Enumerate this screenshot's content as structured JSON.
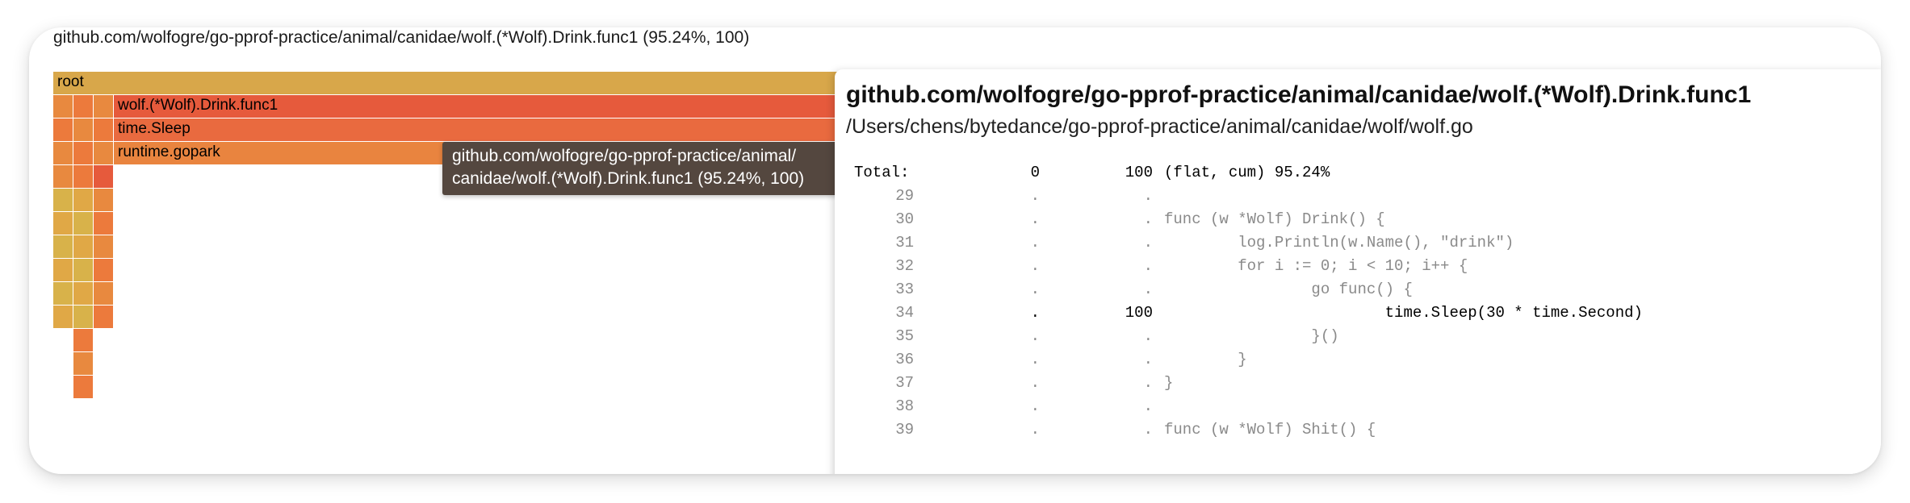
{
  "header": {
    "hover_text": "github.com/wolfogre/go-pprof-practice/animal/canidae/wolf.(*Wolf).Drink.func1 (95.24%, 100)"
  },
  "flamegraph": {
    "frames": [
      {
        "label": "root"
      },
      {
        "label": "wolf.(*Wolf).Drink.func1"
      },
      {
        "label": "time.Sleep"
      },
      {
        "label": "runtime.gopark"
      }
    ]
  },
  "tooltip": {
    "line1": "github.com/wolfogre/go-pprof-practice/animal/",
    "line2": "canidae/wolf.(*Wolf).Drink.func1 (95.24%, 100)"
  },
  "source_panel": {
    "title": "github.com/wolfogre/go-pprof-practice/animal/canidae/wolf.(*Wolf).Drink.func1",
    "path": "/Users/chens/bytedance/go-pprof-practice/animal/canidae/wolf/wolf.go",
    "total": {
      "label": "Total:",
      "flat": "0",
      "cum": "100",
      "text": "(flat, cum) 95.24%"
    },
    "lines": [
      {
        "num": "29",
        "flat": ".",
        "cum": ".",
        "src": ""
      },
      {
        "num": "30",
        "flat": ".",
        "cum": ".",
        "src": "func (w *Wolf) Drink() {"
      },
      {
        "num": "31",
        "flat": ".",
        "cum": ".",
        "src": "        log.Println(w.Name(), \"drink\")"
      },
      {
        "num": "32",
        "flat": ".",
        "cum": ".",
        "src": "        for i := 0; i < 10; i++ {"
      },
      {
        "num": "33",
        "flat": ".",
        "cum": ".",
        "src": "                go func() {"
      },
      {
        "num": "34",
        "flat": ".",
        "cum": "100",
        "src": "                        time.Sleep(30 * time.Second)"
      },
      {
        "num": "35",
        "flat": ".",
        "cum": ".",
        "src": "                }()"
      },
      {
        "num": "36",
        "flat": ".",
        "cum": ".",
        "src": "        }"
      },
      {
        "num": "37",
        "flat": ".",
        "cum": ".",
        "src": "}"
      },
      {
        "num": "38",
        "flat": ".",
        "cum": ".",
        "src": ""
      },
      {
        "num": "39",
        "flat": ".",
        "cum": ".",
        "src": "func (w *Wolf) Shit() {"
      }
    ]
  },
  "colors": {
    "root": "#d8a74a",
    "func1": "#e65a3c",
    "sleep": "#e96a3f",
    "gopark": "#e9843f",
    "yellow_a": "#d8b24a",
    "yellow_b": "#e0a846",
    "orange_a": "#e8893f",
    "orange_b": "#ec7a3c",
    "tooltip_bg": "#54473f"
  }
}
